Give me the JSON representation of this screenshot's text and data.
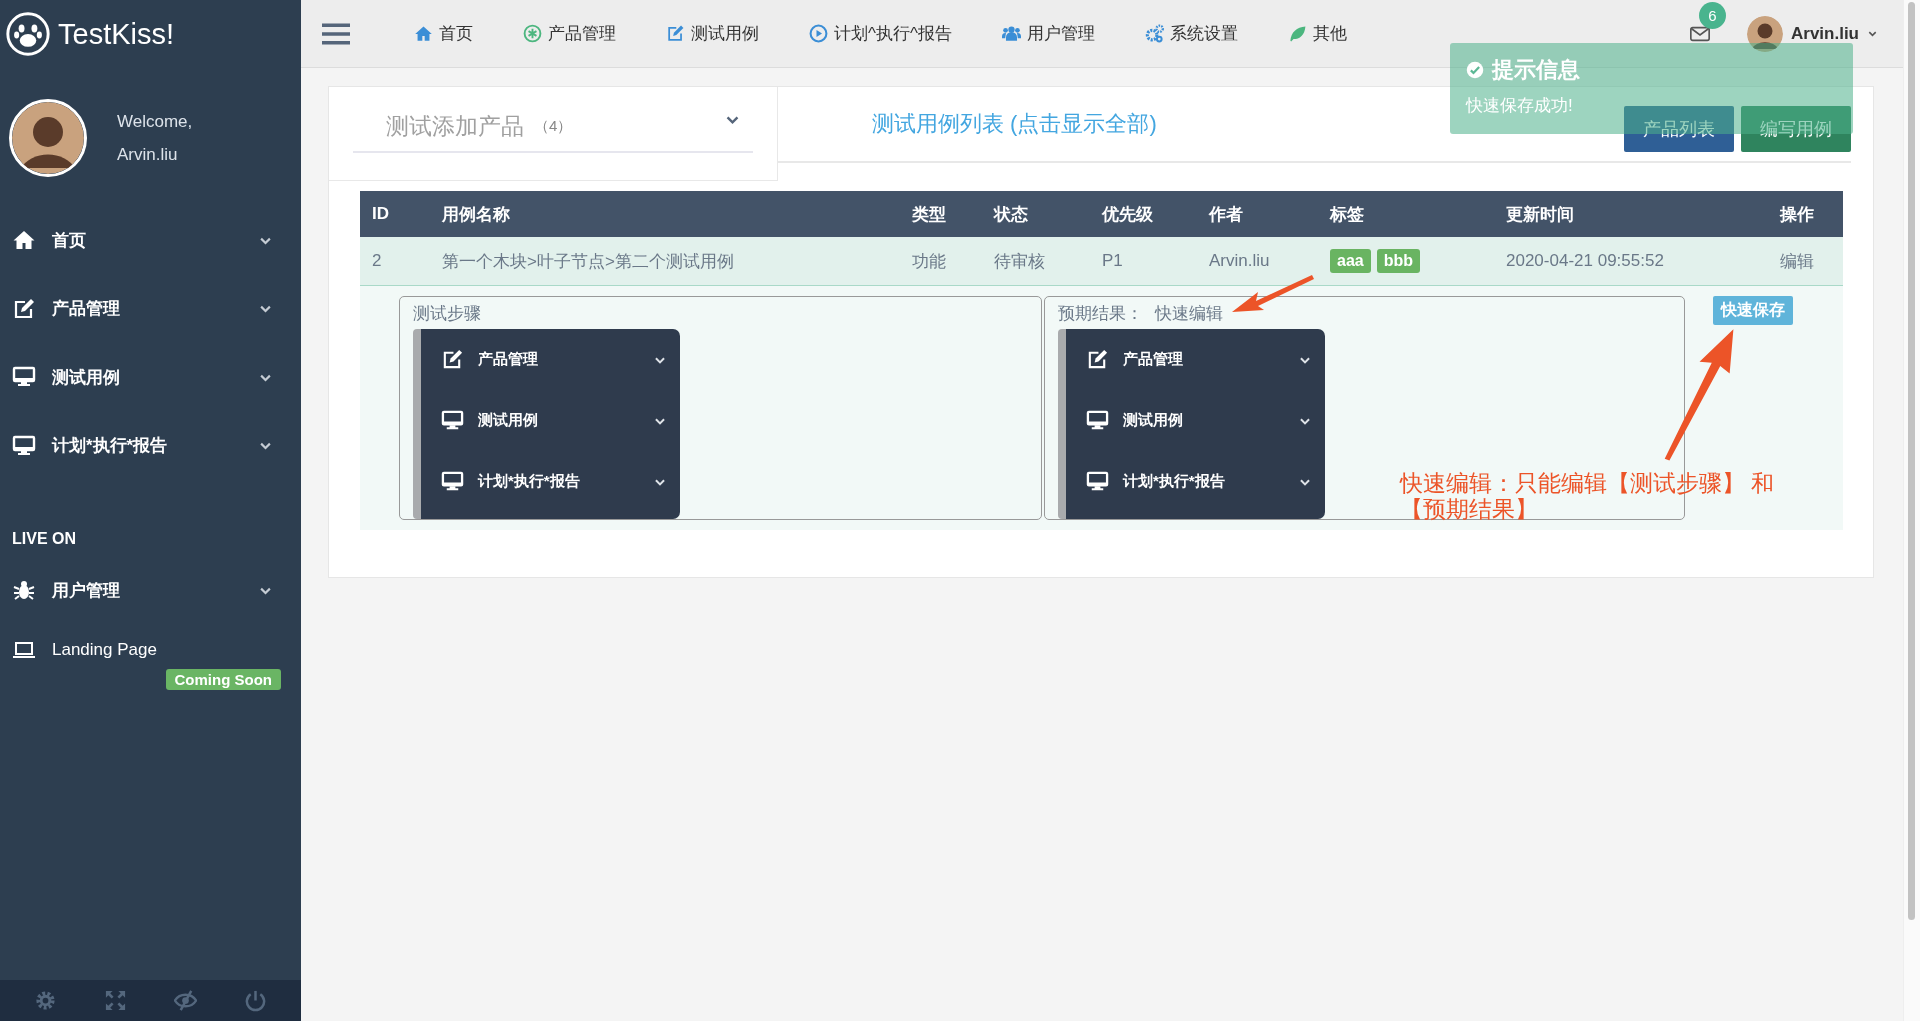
{
  "sidebar": {
    "logo": "TestKiss!",
    "welcome": "Welcome,",
    "user": "Arvin.liu",
    "menu": [
      {
        "label": "首页"
      },
      {
        "label": "产品管理"
      },
      {
        "label": "测试用例"
      },
      {
        "label": "计划*执行*报告"
      }
    ],
    "section": "LIVE ON",
    "live_menu": [
      {
        "label": "用户管理"
      },
      {
        "label": "Landing Page",
        "badge": "Coming Soon"
      }
    ]
  },
  "topbar": {
    "nav": [
      {
        "label": "首页"
      },
      {
        "label": "产品管理"
      },
      {
        "label": "测试用例"
      },
      {
        "label": "计划^执行^报告"
      },
      {
        "label": "用户管理"
      },
      {
        "label": "系统设置"
      },
      {
        "label": "其他"
      }
    ],
    "mail_count": "6",
    "user": "Arvin.liu"
  },
  "panel": {
    "product_select": {
      "value": "测试添加产品",
      "count": "（4）"
    },
    "title": "测试用例列表 (点击显示全部)",
    "buttons": [
      {
        "label": "产品列表",
        "kind": "primary"
      },
      {
        "label": "编写用例",
        "kind": "success"
      }
    ]
  },
  "table": {
    "columns": [
      "ID",
      "用例名称",
      "类型",
      "状态",
      "优先级",
      "作者",
      "标签",
      "更新时间",
      "操作"
    ],
    "rows": [
      {
        "id": "2",
        "name": "第一个木块>叶子节点>第二个测试用例",
        "type": "功能",
        "status": "待审核",
        "priority": "P1",
        "author": "Arvin.liu",
        "tags": [
          "aaa",
          "bbb"
        ],
        "updated": "2020-04-21 09:55:52",
        "action": "编辑"
      }
    ],
    "detail": {
      "steps": {
        "label": "测试步骤",
        "menu": [
          {
            "label": "产品管理"
          },
          {
            "label": "测试用例"
          },
          {
            "label": "计划*执行*报告"
          }
        ]
      },
      "result": {
        "label": "预期结果：",
        "hint": "快速编辑",
        "menu": [
          {
            "label": "产品管理"
          },
          {
            "label": "测试用例"
          },
          {
            "label": "计划*执行*报告"
          }
        ]
      },
      "save_button": "快速保存"
    }
  },
  "toast": {
    "title": "提示信息",
    "message": "快速保存成功!"
  },
  "annotation": "快速编辑：只能编辑【测试步骤】 和【预期结果】"
}
